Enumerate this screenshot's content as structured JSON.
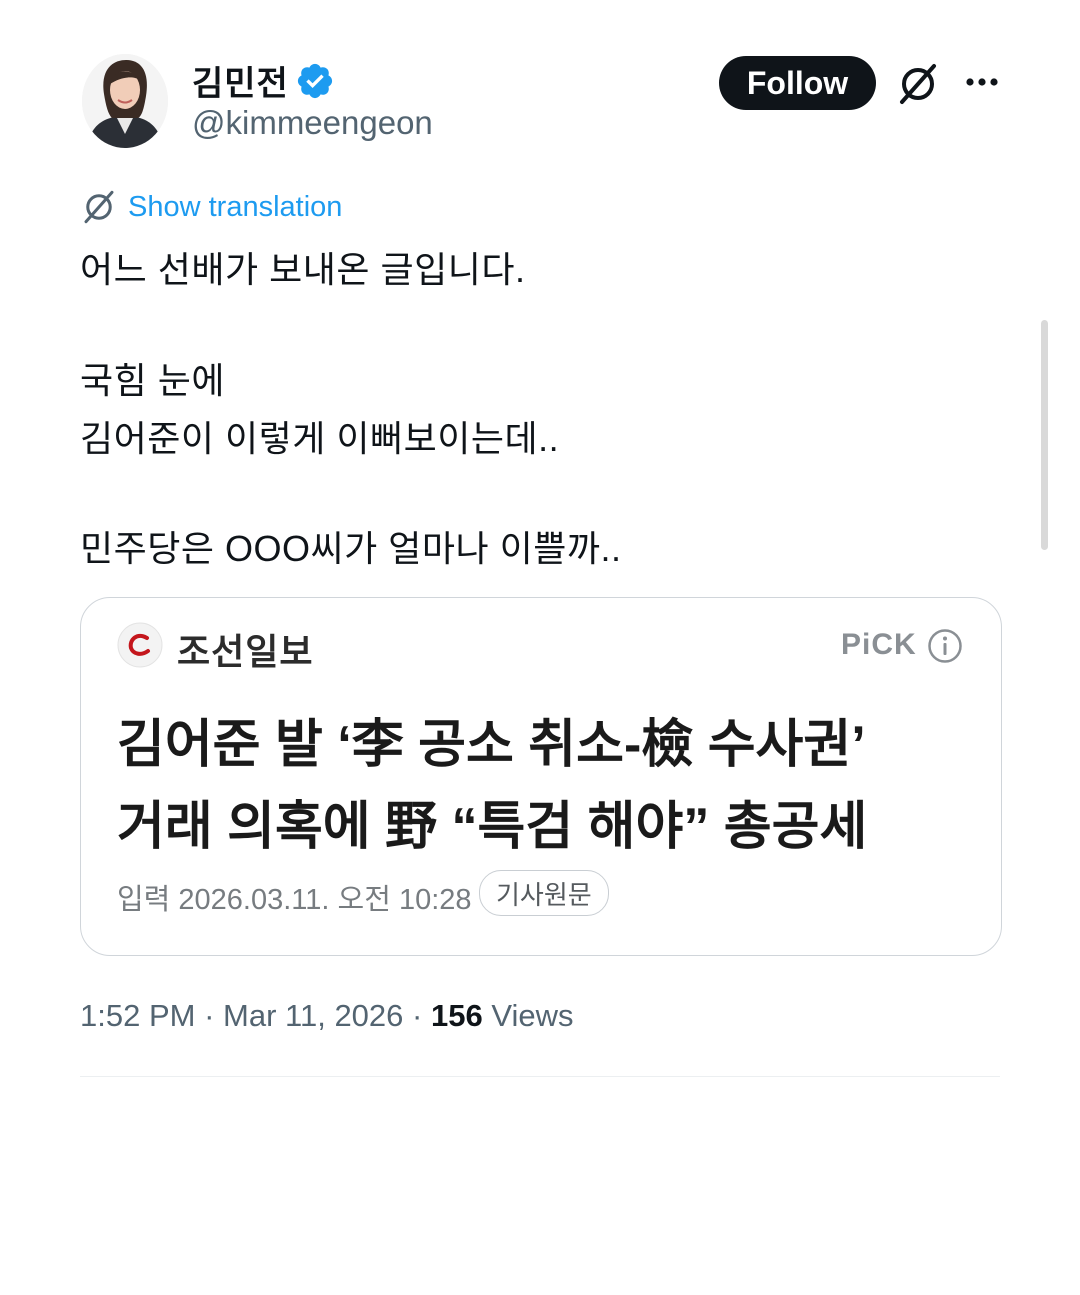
{
  "author": {
    "display_name": "김민전",
    "handle": "@kimmeengeon",
    "verified": true,
    "avatar_icon": "profile-photo"
  },
  "actions": {
    "follow_label": "Follow",
    "grok_icon": "grok-icon",
    "more_icon": "more-dots-icon"
  },
  "translation": {
    "label": "Show translation",
    "icon": "grok-icon"
  },
  "tweet_lines": [
    "어느 선배가 보내온 글입니다.",
    "국힘 눈에",
    "김어준이 이렇게 이뻐보이는데..",
    "민주당은 OOO씨가 얼마나 이쁠까.."
  ],
  "card": {
    "press_name": "조선일보",
    "pick_label": "PiCK",
    "headline_lines": [
      "김어준 발 ‘李 공소 취소-檢 수사권’",
      "거래 의혹에 野 “특검 해야” 총공세"
    ],
    "input_date": "입력 2026.03.11. 오전 10:28",
    "original_link": "기사원문"
  },
  "meta": {
    "time": "1:52 PM",
    "date": "Mar 11, 2026",
    "views_count": "156",
    "views_label": "Views",
    "separator": "·"
  },
  "colors": {
    "link_blue": "#1d9bf0",
    "verified_blue": "#1d9bf0",
    "press_red": "#c4161c",
    "text_primary": "#0f1419",
    "text_secondary": "#536471"
  }
}
